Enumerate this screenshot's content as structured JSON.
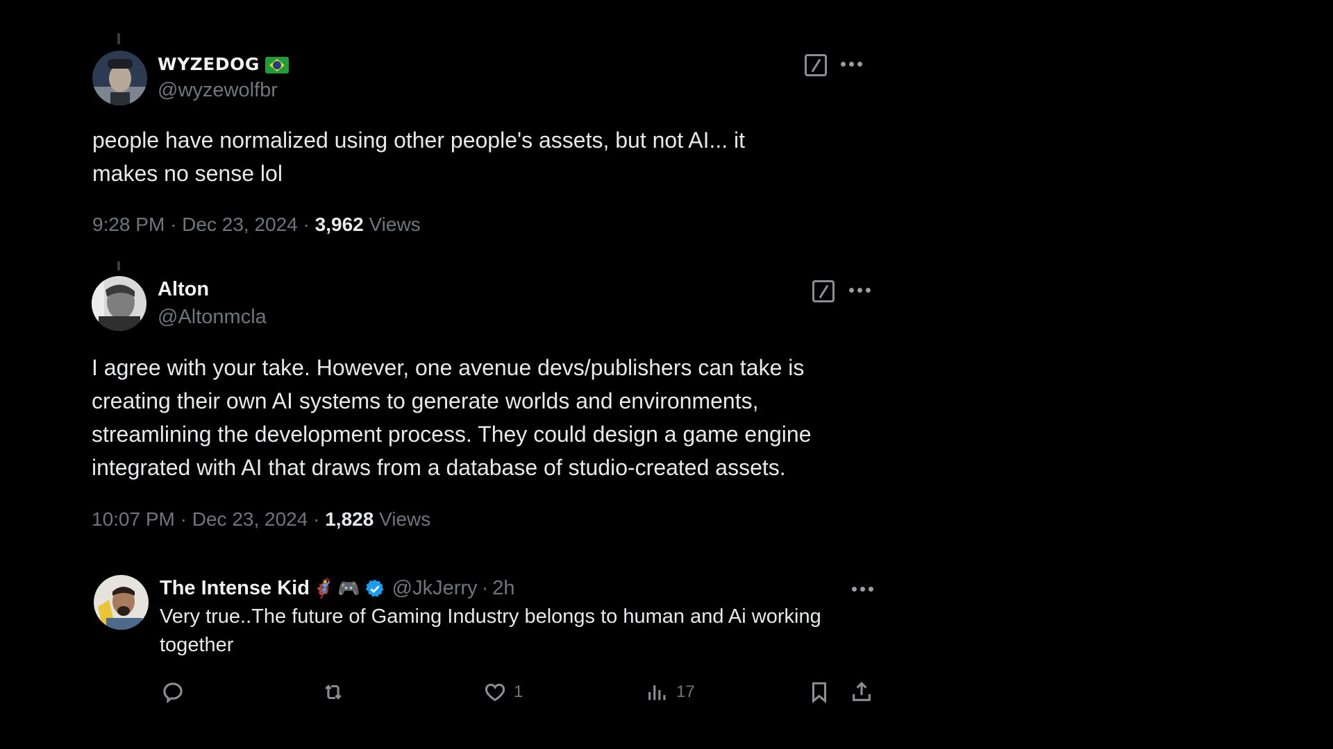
{
  "tweets": [
    {
      "display_name": "WYZEDOG",
      "name_badge": "brazil-flag",
      "handle": "@wyzewolfbr",
      "text_lines": [
        "people have normalized using other people's assets, but not AI... it",
        "makes no sense lol"
      ],
      "time": "9:28 PM",
      "date": "Dec 23, 2024",
      "views_count": "3,962",
      "views_label": "Views",
      "separator": "·"
    },
    {
      "display_name": "Alton",
      "handle": "@Altonmcla",
      "text_lines": [
        "I agree with your take. However, one avenue devs/publishers can take is",
        "creating their own AI systems to generate worlds and environments,",
        "streamlining the development process. They could design a game engine",
        "integrated with AI that draws from a database of studio-created assets."
      ],
      "time": "10:07 PM",
      "date": "Dec 23, 2024",
      "views_count": "1,828",
      "views_label": "Views",
      "separator": "·"
    }
  ],
  "reply": {
    "display_name": "The Intense Kid",
    "emojis": [
      "🦸",
      "🎮"
    ],
    "verified": true,
    "handle": "@JkJerry",
    "separator": "·",
    "age": "2h",
    "text_lines": [
      "Very true..The future of Gaming Industry belongs to human and Ai working",
      "together"
    ],
    "actions": {
      "reply_count": "",
      "retweet_count": "",
      "like_count": "1",
      "views_count": "17"
    }
  },
  "icons": {
    "grok": "grok-icon",
    "more": "more-icon",
    "reply": "reply-icon",
    "retweet": "retweet-icon",
    "like": "heart-icon",
    "views": "analytics-icon",
    "bookmark": "bookmark-icon",
    "share": "share-icon"
  },
  "colors": {
    "background": "#000000",
    "text": "#e7e9ea",
    "secondary_text": "#71767b",
    "verified": "#1d9bf0"
  }
}
